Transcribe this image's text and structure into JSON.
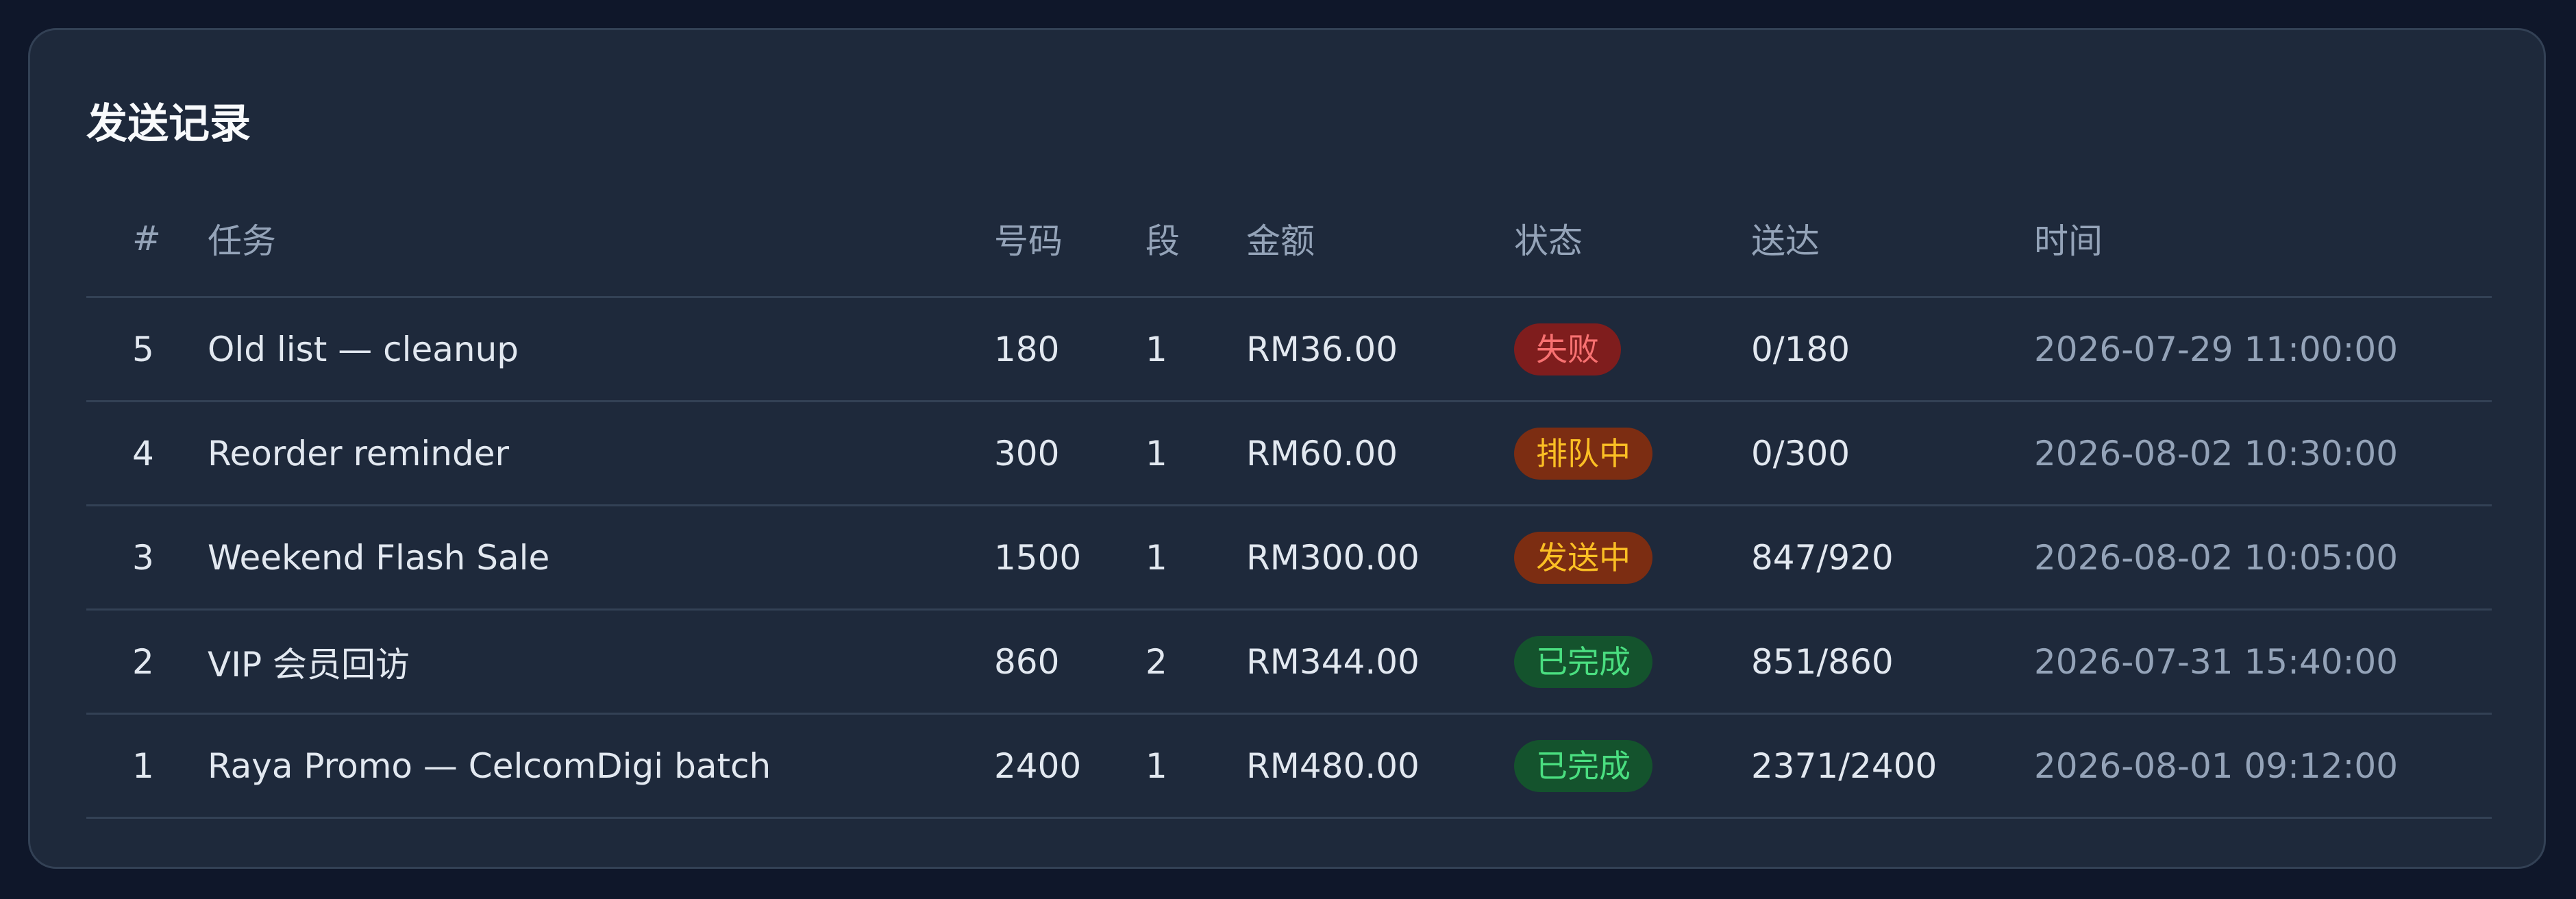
{
  "panel": {
    "title": "发送记录"
  },
  "table": {
    "headers": {
      "idx": "#",
      "task": "任务",
      "numbers": "号码",
      "segments": "段",
      "amount": "金额",
      "status": "状态",
      "delivered": "送达",
      "time": "时间"
    },
    "rows": [
      {
        "idx": "5",
        "task": "Old list — cleanup",
        "numbers": "180",
        "segments": "1",
        "amount": "RM36.00",
        "status": "失败",
        "delivered": "0/180",
        "time": "2026-07-29 11:00:00"
      },
      {
        "idx": "4",
        "task": "Reorder reminder",
        "numbers": "300",
        "segments": "1",
        "amount": "RM60.00",
        "status": "排队中",
        "delivered": "0/300",
        "time": "2026-08-02 10:30:00"
      },
      {
        "idx": "3",
        "task": "Weekend Flash Sale",
        "numbers": "1500",
        "segments": "1",
        "amount": "RM300.00",
        "status": "发送中",
        "delivered": "847/920",
        "time": "2026-08-02 10:05:00"
      },
      {
        "idx": "2",
        "task": "VIP 会员回访",
        "numbers": "860",
        "segments": "2",
        "amount": "RM344.00",
        "status": "已完成",
        "delivered": "851/860",
        "time": "2026-07-31 15:40:00"
      },
      {
        "idx": "1",
        "task": "Raya Promo — CelcomDigi batch",
        "numbers": "2400",
        "segments": "1",
        "amount": "RM480.00",
        "status": "已完成",
        "delivered": "2371/2400",
        "time": "2026-08-01 09:12:00"
      }
    ]
  },
  "status_colors": {
    "失败": {
      "bg": "#7f1d1d",
      "fg": "#f87171"
    },
    "排队中": {
      "bg": "#7c2d12",
      "fg": "#fbbf24"
    },
    "发送中": {
      "bg": "#7c2d12",
      "fg": "#fbbf24"
    },
    "已完成": {
      "bg": "#14532d",
      "fg": "#4ade80"
    }
  },
  "colors": {
    "page_bg": "#0f172a",
    "card_bg": "#1e293b",
    "border": "#334155",
    "text": "#e2e8f0",
    "muted": "#94a3b8"
  }
}
